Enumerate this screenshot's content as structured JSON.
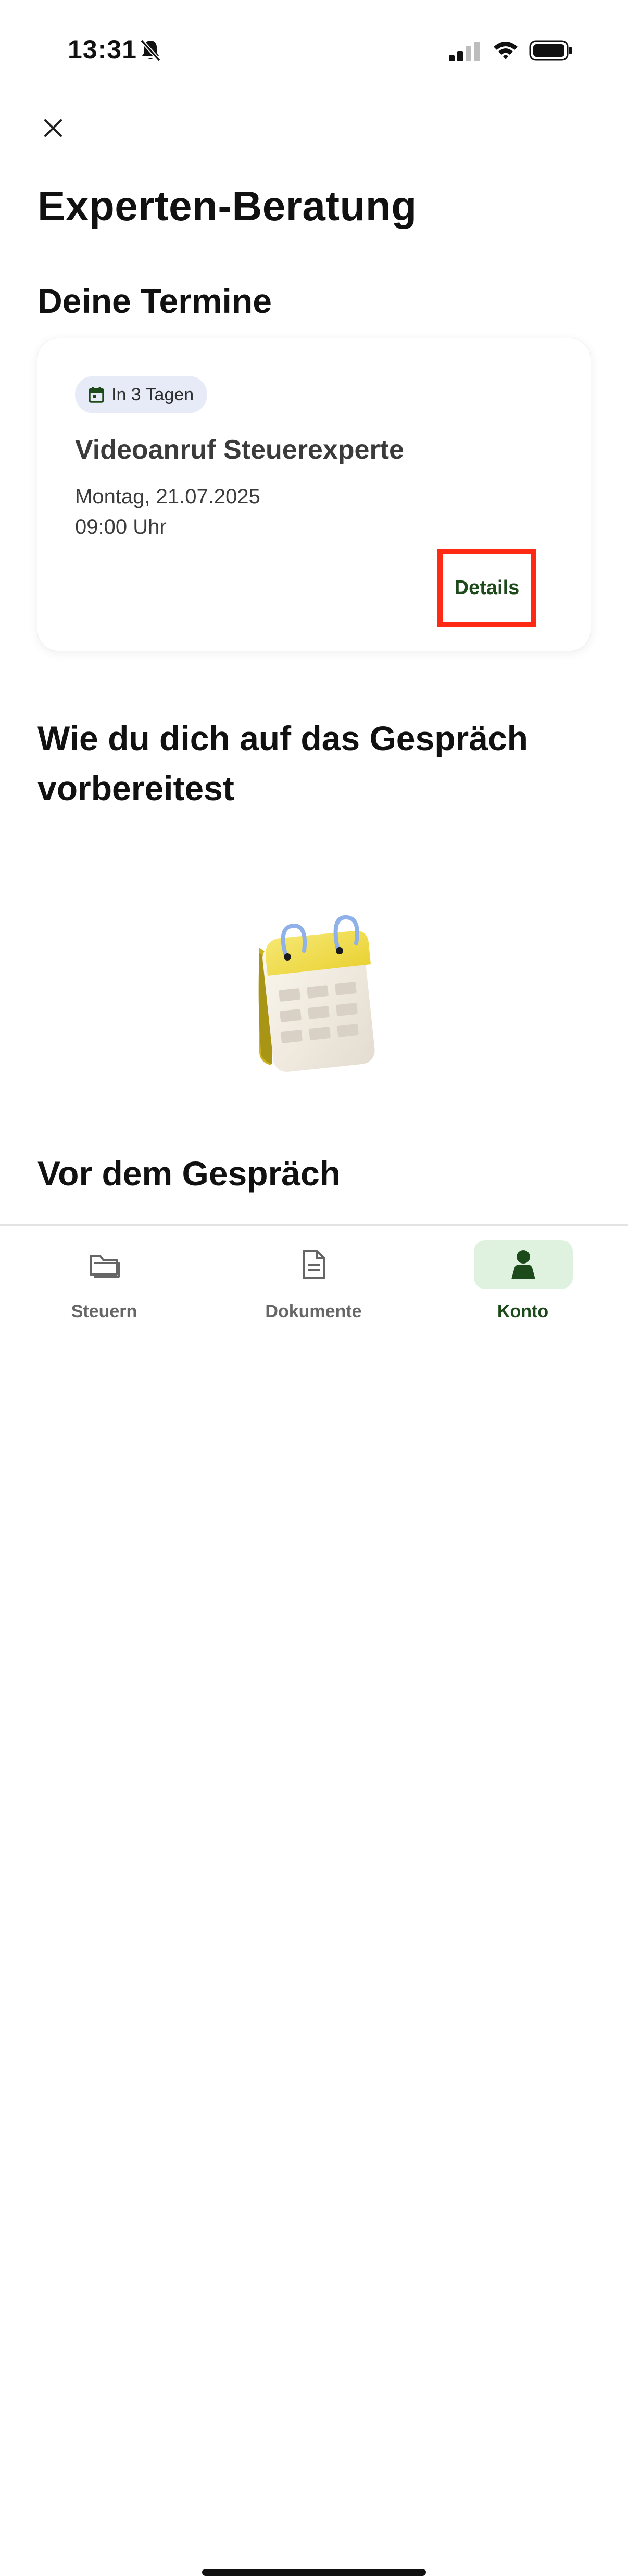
{
  "status_bar": {
    "time": "13:31",
    "icons": [
      "bell-slash-icon",
      "cellular-signal-icon",
      "wifi-icon",
      "battery-icon"
    ]
  },
  "header": {
    "close_icon": "close-icon",
    "title": "Experten-Beratung"
  },
  "appointments": {
    "section_title": "Deine Termine",
    "card": {
      "badge_icon": "calendar-icon",
      "badge_label": "In 3 Tagen",
      "title": "Videoanruf Steuerexperte",
      "date": "Montag, 21.07.2025",
      "time": "09:00 Uhr",
      "details_label": "Details"
    }
  },
  "preparation": {
    "section_title": "Wie du dich auf das Gespräch vorbereitest",
    "illustration": "calendar-illustration",
    "subsection_title": "Vor dem Gespräch"
  },
  "tab_bar": {
    "tabs": [
      {
        "label": "Steuern",
        "icon": "folder-icon",
        "active": false
      },
      {
        "label": "Dokumente",
        "icon": "document-icon",
        "active": false
      },
      {
        "label": "Konto",
        "icon": "person-icon",
        "active": true
      }
    ]
  },
  "colors": {
    "accent_green": "#1d4a1a",
    "active_tab_bg": "#dff2df",
    "badge_bg": "#e6ebf7",
    "highlight_red": "#ff2a14"
  }
}
